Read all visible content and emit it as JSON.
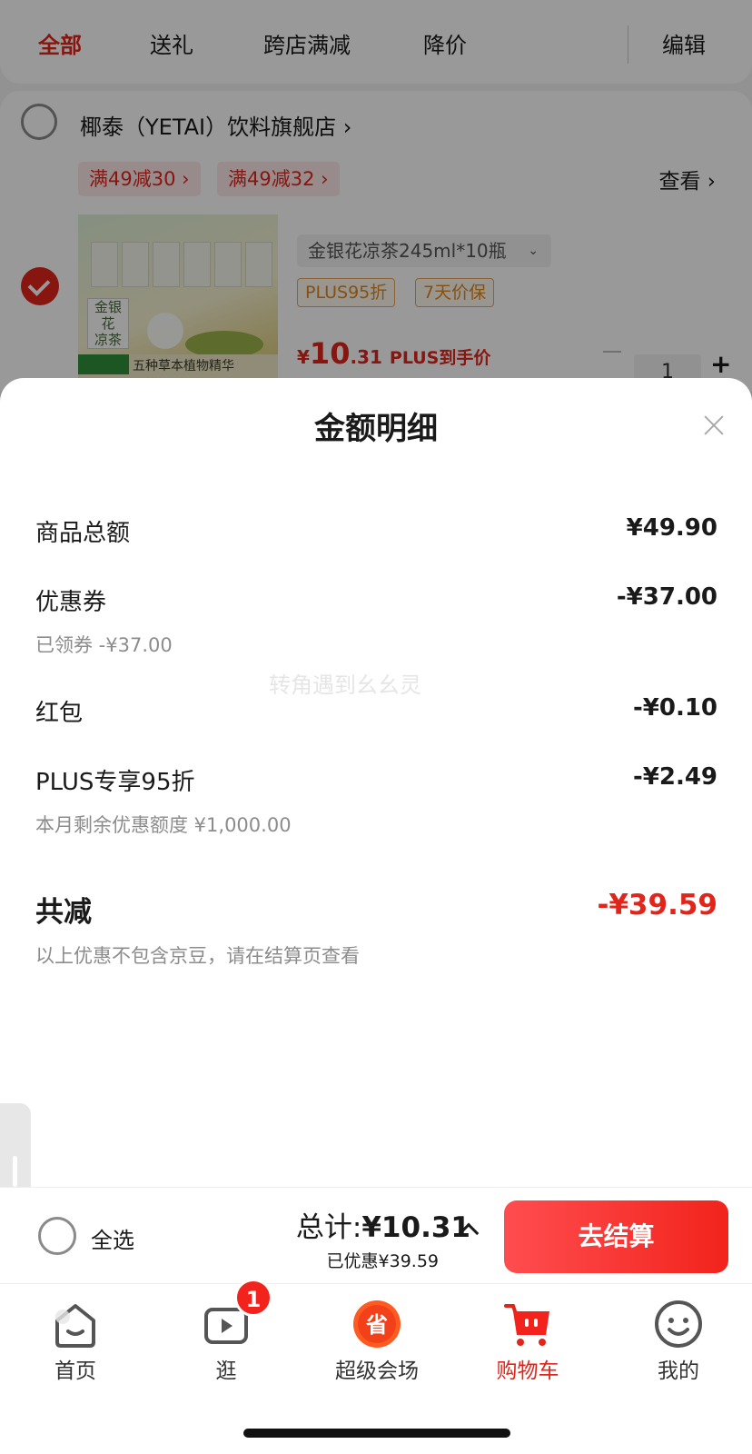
{
  "tabs": [
    {
      "label": "全部",
      "active": true
    },
    {
      "label": "送礼"
    },
    {
      "label": "跨店满减"
    },
    {
      "label": "降价"
    }
  ],
  "edit_label": "编辑",
  "store": {
    "name": "椰泰（YETAI）饮料旗舰店 ›",
    "promos": [
      "满49减30 ›",
      "满49减32 ›"
    ],
    "view_more": "查看 ›"
  },
  "product": {
    "image_texts": [
      "金银花",
      "凉茶",
      "五种草本植物精华"
    ],
    "variant": "金银花凉茶245ml*10瓶",
    "variant_caret": "⌄",
    "tags": [
      "PLUS95折",
      "7天价保"
    ],
    "price_symbol": "¥",
    "price_int": "10",
    "price_dec": ".31",
    "price_note": "PLUS到手价",
    "quantity": "1",
    "plus": "+"
  },
  "sheet": {
    "title": "金额明细",
    "close_icon": "close-icon",
    "rows": [
      {
        "label": "商品总额",
        "value": "¥49.90"
      },
      {
        "label": "优惠券",
        "value": "-¥37.00",
        "sub": "已领券 -¥37.00"
      },
      {
        "label": "红包",
        "value": "-¥0.10"
      },
      {
        "label": "PLUS专享95折",
        "value": "-¥2.49",
        "sub": "本月剩余优惠额度 ¥1,000.00"
      }
    ],
    "total_label": "共减",
    "total_value": "-¥39.59",
    "note": "以上优惠不包含京豆，请在结算页查看",
    "watermark": "转角遇到幺幺灵"
  },
  "checkout": {
    "select_all": "全选",
    "total_prefix": "总计:",
    "total_amount": "¥10.31",
    "saved": "已优惠¥39.59",
    "button": "去结算"
  },
  "tabbar": [
    {
      "label": "首页",
      "icon": "home-icon"
    },
    {
      "label": "逛",
      "icon": "video-play-icon",
      "badge": "1"
    },
    {
      "label": "超级会场",
      "icon": "save-sale-icon",
      "icon_text": "省"
    },
    {
      "label": "购物车",
      "icon": "shopping-cart-icon",
      "active": true
    },
    {
      "label": "我的",
      "icon": "smiley-profile-icon"
    }
  ],
  "colors": {
    "accent": "#e1251b",
    "checkout_button": "#f2231c",
    "tag_orange": "#e0861f"
  }
}
